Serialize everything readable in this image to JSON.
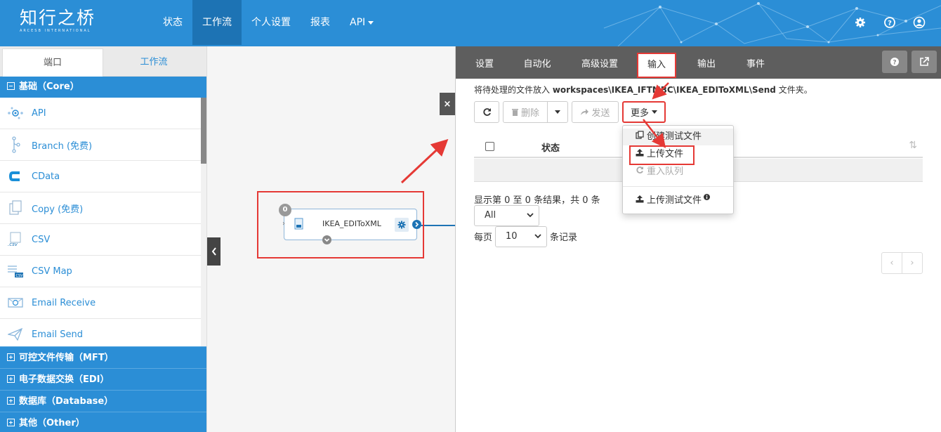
{
  "app": {
    "logo_cn": "知行之桥",
    "logo_en": "ARCESB INTERNATIONAL",
    "nav": [
      {
        "label": "状态"
      },
      {
        "label": "工作流"
      },
      {
        "label": "个人设置"
      },
      {
        "label": "报表"
      },
      {
        "label": "API"
      }
    ]
  },
  "sidebar": {
    "tabs": [
      "端口",
      "工作流"
    ],
    "core_header": "基础（Core）",
    "items": [
      {
        "label": "API",
        "icon": "api-icon"
      },
      {
        "label": "Branch (免费)",
        "icon": "branch-icon"
      },
      {
        "label": "CData",
        "icon": "cdata-icon"
      },
      {
        "label": "Copy (免费)",
        "icon": "copy-icon"
      },
      {
        "label": "CSV",
        "icon": "csv-icon"
      },
      {
        "label": "CSV Map",
        "icon": "csv-map-icon"
      },
      {
        "label": "Email Receive",
        "icon": "email-receive-icon"
      },
      {
        "label": "Email Send",
        "icon": "email-send-icon"
      }
    ],
    "groups": [
      "可控文件传输（MFT）",
      "电子数据交换（EDI）",
      "数据库（Database）",
      "其他（Other）"
    ]
  },
  "canvas": {
    "node_label": "IKEA_EDIToXML",
    "node_badge": "0"
  },
  "panel": {
    "tabs": [
      "设置",
      "自动化",
      "高级设置",
      "输入",
      "输出",
      "事件"
    ],
    "active_tab": "输入",
    "hint_prefix": "将待处理的文件放入 ",
    "hint_path": "workspaces\\IKEA_IFTMBC\\IKEA_EDIToXML\\Send",
    "hint_suffix": " 文件夹。",
    "buttons": {
      "delete": "删除",
      "send": "发送",
      "more": "更多"
    },
    "table": {
      "col_status": "状态"
    },
    "info": "显示第 0 至 0 条结果，共 0 条",
    "filter_value": "All",
    "per_page_label": "每页",
    "per_page_value": "10",
    "per_page_suffix": "条记录",
    "pager": [
      "‹",
      "›"
    ],
    "menu": [
      {
        "label": "创建测试文件",
        "disabled": false
      },
      {
        "label": "上传文件",
        "disabled": false
      },
      {
        "label": "重入队列",
        "disabled": true
      },
      {
        "label": "上传测试文件",
        "disabled": false
      }
    ]
  },
  "colors": {
    "brand": "#2b8ed6",
    "nav_active": "#1d73b4",
    "highlight": "#e53935",
    "panel_tabs_bg": "#5e5e5e"
  }
}
